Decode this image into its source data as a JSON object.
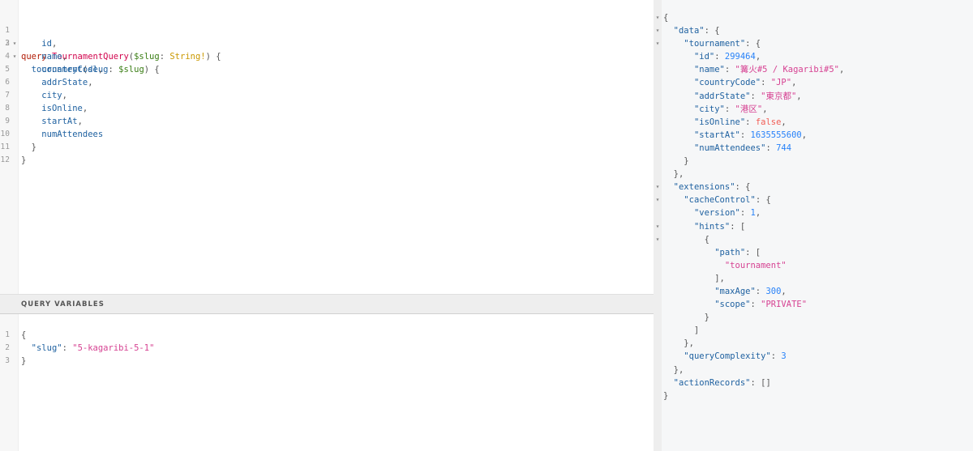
{
  "query_editor": {
    "line_numbers": [
      "1",
      "2",
      "3",
      "4",
      "5",
      "6",
      "7",
      "8",
      "9",
      "10",
      "11",
      "12"
    ],
    "keyword": "query",
    "operation_name": "TournamentQuery",
    "variable": "$slug",
    "type": "String!",
    "root_field": "tournament",
    "arg_name": "slug",
    "arg_var": "$slug",
    "fields": [
      "id",
      "name",
      "countryCode",
      "addrState",
      "city",
      "isOnline",
      "startAt",
      "numAttendees"
    ]
  },
  "variables_panel": {
    "title": "QUERY VARIABLES",
    "line_numbers": [
      "1",
      "2",
      "3"
    ],
    "key": "\"slug\"",
    "value": "\"5-kagaribi-5-1\""
  },
  "result": {
    "data_key": "\"data\"",
    "tournament_key": "\"tournament\"",
    "id_key": "\"id\"",
    "id_value": "299464",
    "name_key": "\"name\"",
    "name_value": "\"篝火#5 / Kagaribi#5\"",
    "country_key": "\"countryCode\"",
    "country_value": "\"JP\"",
    "addr_key": "\"addrState\"",
    "addr_value": "\"東京都\"",
    "city_key": "\"city\"",
    "city_value": "\"港区\"",
    "online_key": "\"isOnline\"",
    "online_value": "false",
    "start_key": "\"startAt\"",
    "start_value": "1635555600",
    "attendees_key": "\"numAttendees\"",
    "attendees_value": "744",
    "extensions_key": "\"extensions\"",
    "cache_key": "\"cacheControl\"",
    "version_key": "\"version\"",
    "version_value": "1",
    "hints_key": "\"hints\"",
    "path_key": "\"path\"",
    "path_value": "\"tournament\"",
    "maxage_key": "\"maxAge\"",
    "maxage_value": "300",
    "scope_key": "\"scope\"",
    "scope_value": "\"PRIVATE\"",
    "complexity_key": "\"queryComplexity\"",
    "complexity_value": "3",
    "actions_key": "\"actionRecords\""
  }
}
